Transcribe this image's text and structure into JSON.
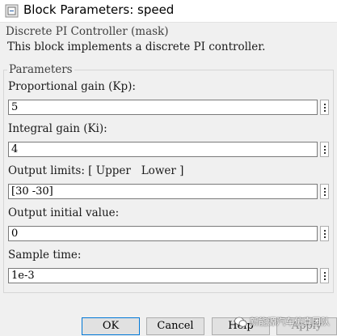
{
  "window": {
    "title": "Block Parameters: speed",
    "icon": "simulink-block-icon"
  },
  "mask": {
    "title": "Discrete PI Controller (mask)",
    "description": "This block implements a discrete PI controller."
  },
  "parameters": {
    "group_title": "Parameters",
    "fields": [
      {
        "label": "Proportional gain (Kp):",
        "value": "5"
      },
      {
        "label": "Integral gain (Ki):",
        "value": "4"
      },
      {
        "label": "Output limits: [ Upper   Lower ]",
        "value": "[30 -30]"
      },
      {
        "label": "Output initial value:",
        "value": "0"
      },
      {
        "label": "Sample time:",
        "value": "1e-3"
      }
    ]
  },
  "buttons": {
    "ok": "OK",
    "cancel": "Cancel",
    "help": "Help",
    "apply": "Apply"
  },
  "watermark": {
    "text": "新能源汽车仿真团队"
  },
  "colors": {
    "accent": "#0078d7",
    "window_bg": "#f0f0f0"
  }
}
